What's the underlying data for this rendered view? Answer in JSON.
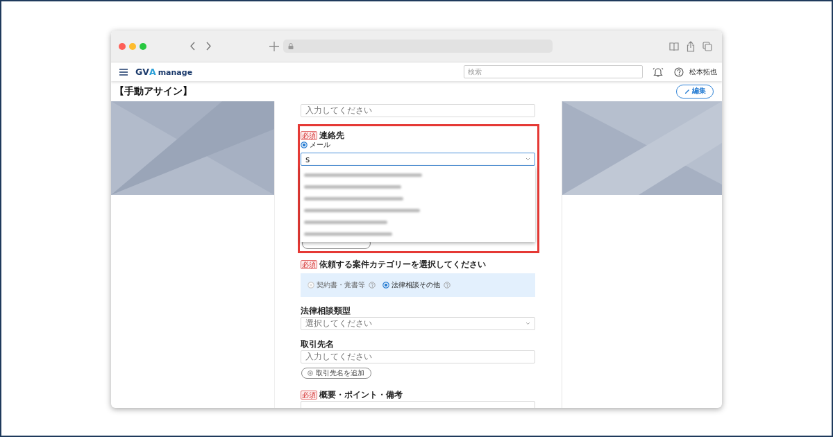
{
  "app": {
    "logo": {
      "brand": "GVA",
      "product": "manage"
    },
    "search": {
      "placeholder": "検索"
    },
    "user": "松本拓也"
  },
  "page": {
    "title": "【手動アサイン】",
    "edit_button": "編集"
  },
  "form": {
    "top_field": {
      "placeholder": "入力してください"
    },
    "contact": {
      "badge": "必須",
      "label": "連絡先",
      "highlighted": true,
      "methods": [
        {
          "label": "メール",
          "selected": true
        }
      ],
      "value": "s",
      "options": [
        {
          "kind": "blurred"
        },
        {
          "kind": "blurred"
        },
        {
          "kind": "blurred"
        },
        {
          "kind": "blurred"
        },
        {
          "kind": "blurred"
        },
        {
          "kind": "blurred"
        }
      ]
    },
    "category": {
      "badge": "必須",
      "label": "依頼する案件カテゴリーを選択してください",
      "options": [
        {
          "label": "契約書・覚書等",
          "selected": false,
          "disabled": true
        },
        {
          "label": "法律相談その他",
          "selected": true,
          "disabled": false
        }
      ]
    },
    "consult_type": {
      "label": "法律相談類型",
      "placeholder": "選択してください"
    },
    "client": {
      "label": "取引先名",
      "placeholder": "入力してください",
      "add_button": "取引先名を追加"
    },
    "summary": {
      "badge": "必須",
      "label": "概要・ポイント・備考"
    }
  }
}
